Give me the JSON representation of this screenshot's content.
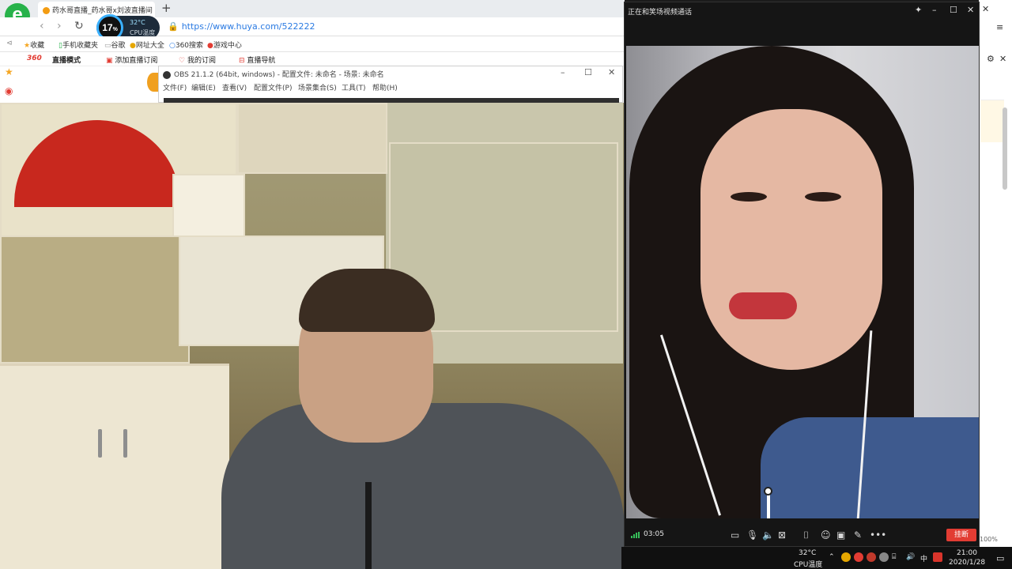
{
  "browser": {
    "tab_title": "药水哥直播_药水哥x刘波直播间",
    "url": "https://www.huya.com/522222",
    "cpu_widget": {
      "load_percent": "17",
      "load_unit": "%",
      "temperature": "32°C",
      "label": "CPU温度"
    },
    "bookmarks": [
      "收藏",
      "手机收藏夹",
      "谷歌",
      "网址大全",
      "360搜索",
      "游戏中心"
    ],
    "site_nav": [
      "直播模式",
      "添加直播订阅",
      "我的订阅",
      "直播导航"
    ],
    "site_logo": "360"
  },
  "obs": {
    "title": "OBS 21.1.2 (64bit, windows) - 配置文件: 未命名 - 场景: 未命名",
    "menu": [
      "文件(F)",
      "编辑(E)",
      "查看(V)",
      "配置文件(P)",
      "场景集合(S)",
      "工具(T)",
      "帮助(H)"
    ]
  },
  "call": {
    "title": "正在和笑场视频通话",
    "timer": "03:05",
    "hangup_label": "挂断"
  },
  "right_strip": {
    "zoom": "100%"
  },
  "taskbar": {
    "temperature": "32°C",
    "cpu_label": "CPU温度",
    "ime": "中",
    "time": "21:00",
    "date": "2020/1/28"
  },
  "icons": {
    "pin": "pin-icon",
    "minimize": "minimize-icon",
    "maximize": "maximize-icon",
    "close": "close-icon",
    "chat": "chat-icon",
    "mic": "mic-icon",
    "speaker": "speaker-icon",
    "camera-off": "camera-off-icon",
    "screenshot": "screenshot-icon",
    "beauty": "beauty-icon",
    "layout": "layout-icon",
    "edit": "edit-icon",
    "more": "more-icon"
  }
}
